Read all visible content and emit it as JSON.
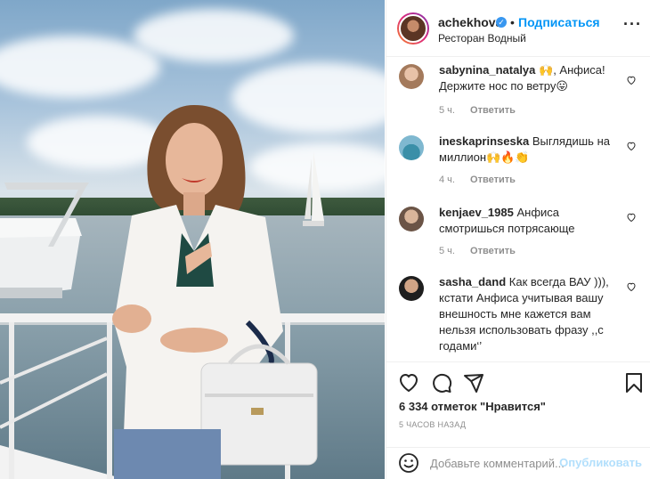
{
  "post": {
    "username": "achekhova",
    "follow_label": "Подписаться",
    "separator": "•",
    "location": "Ресторан Водный",
    "more_label": "···"
  },
  "comments": [
    {
      "username": "sabynina_natalya",
      "text": "🙌, Анфиса! Держите нос по ветру😛",
      "time": "5 ч.",
      "reply": "Ответить"
    },
    {
      "username": "ineskaprinseska",
      "text": "Выглядишь на миллион🙌🔥👏",
      "time": "4 ч.",
      "reply": "Ответить"
    },
    {
      "username": "kenjaev_1985",
      "text": "Анфиса смотришься потрясающе",
      "time": "5 ч.",
      "reply": "Ответить"
    },
    {
      "username": "sasha_dand",
      "text": "Как всегда ВАУ ))), кстати Анфиса учитывая вашу внешность мне кажется вам нельзя использовать фразу ,,с годами‘’",
      "time": "",
      "reply": ""
    }
  ],
  "stats": {
    "likes": "6 334 отметок \"Нравится\"",
    "time": "5 ЧАСОВ НАЗАД"
  },
  "composer": {
    "placeholder": "Добавьте комментарий...",
    "publish": "Опубликовать"
  },
  "icons": [
    "verified-icon",
    "more-icon",
    "heart-icon",
    "comment-icon",
    "share-icon",
    "bookmark-icon",
    "emoji-icon"
  ],
  "colors": {
    "accent": "#0095f6",
    "publish_disabled": "#b2dffc",
    "muted": "#8e8e8e",
    "border": "#efefef"
  }
}
